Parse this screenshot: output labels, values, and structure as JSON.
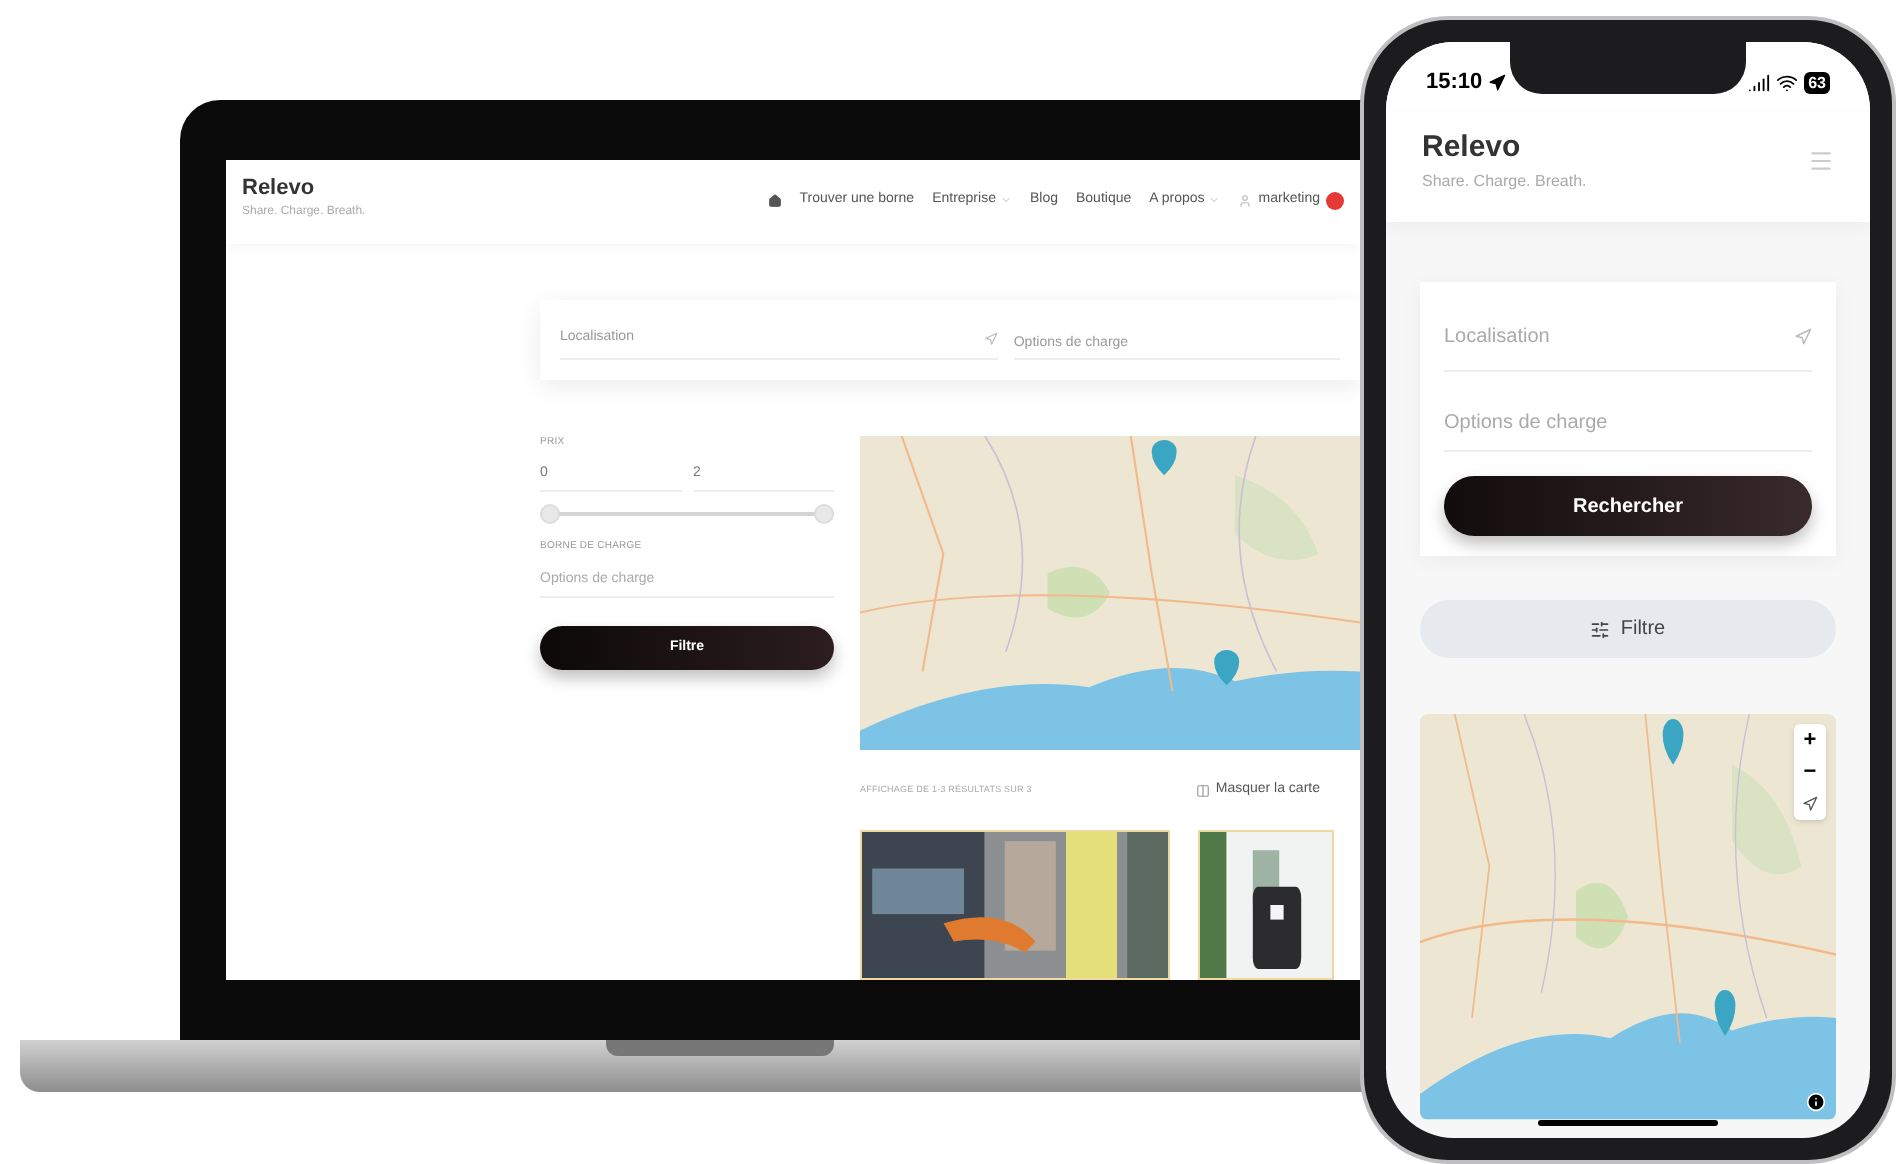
{
  "laptop": {
    "header": {
      "logo": "Relevo",
      "tagline": "Share. Charge. Breath.",
      "nav": [
        {
          "kind": "home"
        },
        {
          "kind": "link",
          "label": "Trouver une borne"
        },
        {
          "kind": "dropdown",
          "label": "Entreprise"
        },
        {
          "kind": "link",
          "label": "Blog"
        },
        {
          "kind": "link",
          "label": "Boutique"
        },
        {
          "kind": "dropdown",
          "label": "A propos"
        },
        {
          "kind": "user",
          "label": "marketing",
          "has_notification": true
        }
      ]
    },
    "search": {
      "location_placeholder": "Localisation",
      "options_placeholder": "Options de charge"
    },
    "filters": {
      "price_label": "PRIX",
      "price_min": "0",
      "price_max": "2",
      "price_range": {
        "level": 1
      },
      "charger_label": "BORNE DE CHARGE",
      "options_placeholder": "Options de charge",
      "button": "Filtre"
    },
    "results": {
      "summary": "AFFICHAGE DE 1-3 RÉSULTATS SUR 3",
      "map_toggle": "Masquer la carte"
    }
  },
  "phone": {
    "status_bar": {
      "time": "15:10",
      "battery": "63"
    },
    "header": {
      "logo": "Relevo",
      "tagline": "Share. Charge. Breath."
    },
    "search": {
      "location_placeholder": "Localisation",
      "options_placeholder": "Options de charge",
      "button": "Rechercher"
    },
    "filter_button": "Filtre",
    "map_controls": [
      "+",
      "−"
    ]
  }
}
